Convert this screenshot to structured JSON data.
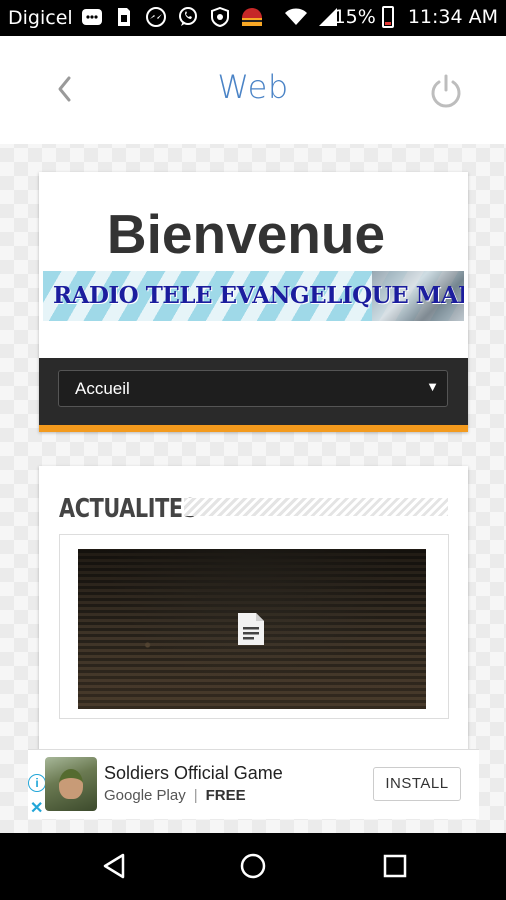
{
  "status_bar": {
    "carrier": "Digicel",
    "battery": "15%",
    "time": "11:34 AM",
    "icons": [
      "bbm-icon",
      "sim-icon",
      "messenger-icon",
      "whatsapp-icon",
      "shield-icon",
      "app-icon",
      "wifi-icon",
      "signal-icon",
      "battery-icon"
    ]
  },
  "header": {
    "title": "Web"
  },
  "welcome_card": {
    "heading": "Bienvenue",
    "banner_text": "RADIO TELE EVANGELIQUE MARANATHA",
    "menu_select_value": "Accueil"
  },
  "news_card": {
    "heading": "ACTUALITES"
  },
  "ad": {
    "title": "Soldiers Official Game",
    "store": "Google Play",
    "separator": "|",
    "price": "FREE",
    "install_label": "INSTALL",
    "info_glyph": "i",
    "close_glyph": "✕"
  },
  "colors": {
    "accent": "#4a83c6",
    "orange_bar": "#f39a1d",
    "nav_dark": "#2a2a2a"
  }
}
